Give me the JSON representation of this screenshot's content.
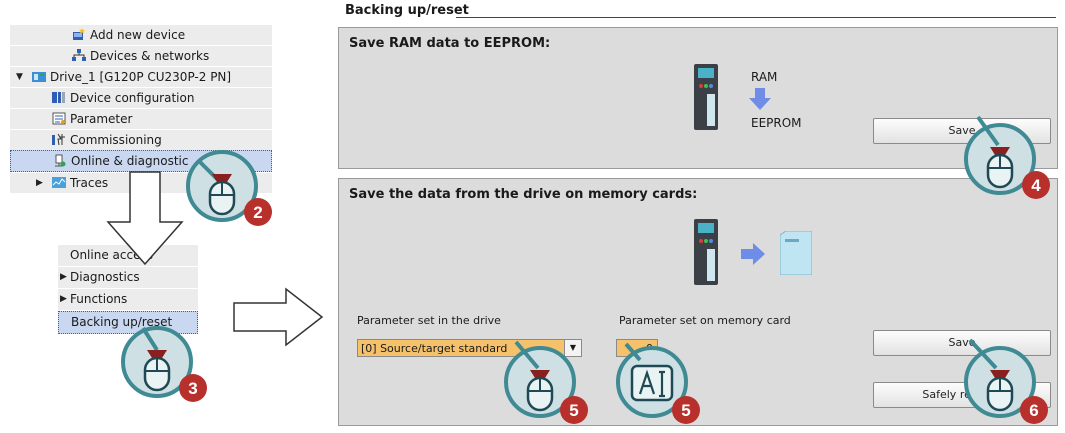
{
  "tree": {
    "items": [
      {
        "label": "Add new device",
        "icon": "add-device-icon"
      },
      {
        "label": "Devices & networks",
        "icon": "network-icon"
      },
      {
        "label": "Drive_1 [G120P CU230P-2 PN]",
        "icon": "drive-icon"
      },
      {
        "label": "Device configuration",
        "icon": "device-config-icon"
      },
      {
        "label": "Parameter",
        "icon": "parameter-icon"
      },
      {
        "label": "Commissioning",
        "icon": "commissioning-icon"
      },
      {
        "label": "Online & diagnostic",
        "icon": "online-diagnostics-icon"
      },
      {
        "label": "Traces",
        "icon": "traces-icon"
      }
    ]
  },
  "menu": {
    "items": [
      {
        "label": "Online access"
      },
      {
        "label": "Diagnostics"
      },
      {
        "label": "Functions"
      },
      {
        "label": "Backing up/reset"
      }
    ]
  },
  "panel": {
    "title": "Backing up/reset",
    "ram_section": {
      "title": "Save RAM data to EEPROM:",
      "ram_label": "RAM",
      "eeprom_label": "EEPROM",
      "save_label": "Save"
    },
    "card_section": {
      "title": "Save the data from the drive on memory cards:",
      "drive_param_label": "Parameter set in the drive",
      "drive_param_value": "[0] Source/target standard",
      "card_param_label": "Parameter set on memory card",
      "card_param_value": "0",
      "save_label": "Save",
      "safely_remove_label": "Safely remove"
    }
  },
  "steps": [
    "2",
    "3",
    "4",
    "5",
    "5",
    "6"
  ],
  "colors": {
    "callout_fill": "#cfe0e4",
    "callout_ring": "#3f8a93",
    "step_badge": "#b8302c",
    "selected_row": "#c9d8f0",
    "field_orange": "#f5c26b",
    "arrow_blue": "#6f8de6"
  }
}
